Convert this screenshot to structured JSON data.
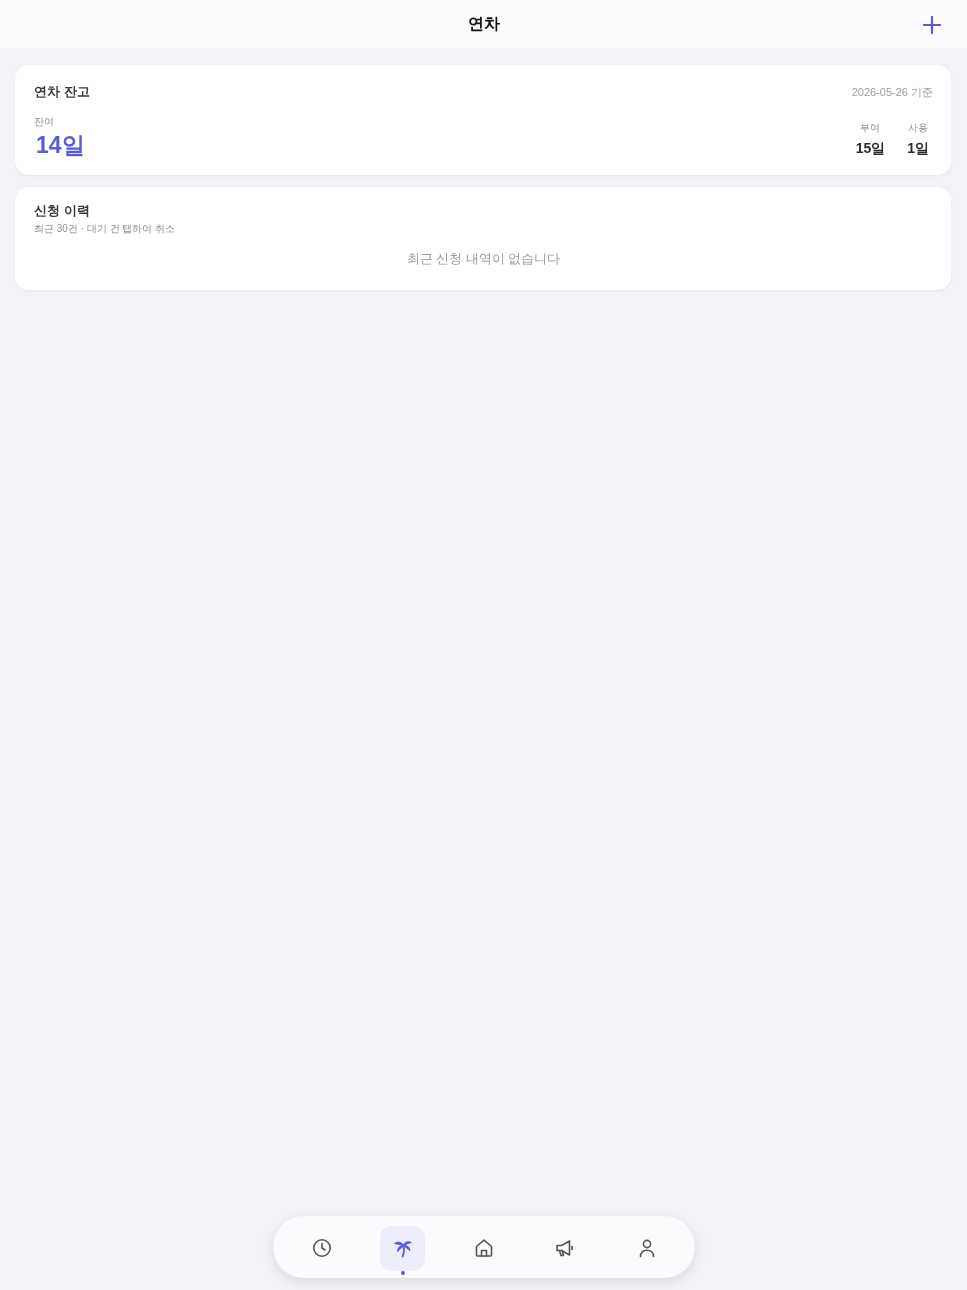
{
  "header": {
    "title": "연차"
  },
  "balance_card": {
    "title": "연차 잔고",
    "as_of": "2026-05-26 기준",
    "remaining": {
      "label": "잔여",
      "value": "14일"
    },
    "stats": [
      {
        "label": "부여",
        "value": "15일"
      },
      {
        "label": "사용",
        "value": "1일"
      }
    ]
  },
  "history_card": {
    "title": "신청 이력",
    "subtitle": "최근 30건 · 대기 건 탭하여 취소",
    "empty_text": "최근 신청 내역이 없습니다"
  },
  "tab_bar": {
    "items": [
      {
        "selected": false
      },
      {
        "selected": true
      },
      {
        "selected": false
      },
      {
        "selected": false
      },
      {
        "selected": false
      }
    ]
  }
}
